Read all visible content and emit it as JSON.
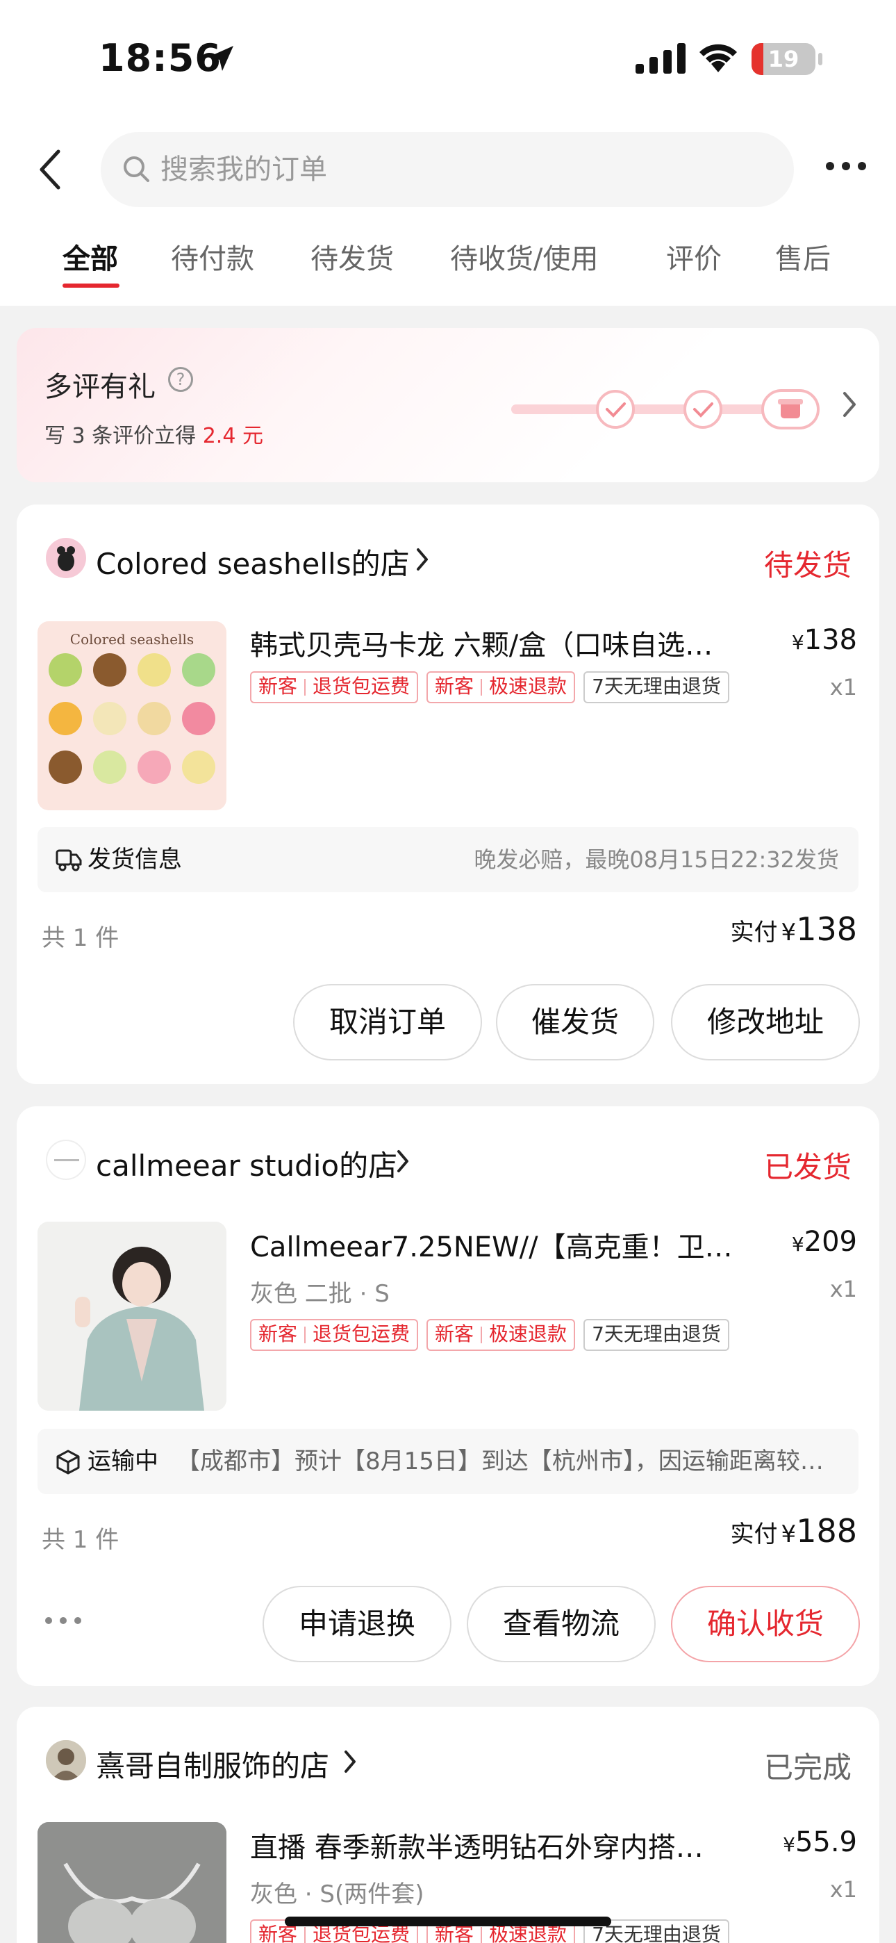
{
  "status_bar": {
    "time": "18:56",
    "battery": "19",
    "battery_level": 0.19
  },
  "nav": {
    "search_placeholder": "搜索我的订单"
  },
  "tabs": [
    {
      "label": "全部",
      "active": true
    },
    {
      "label": "待付款",
      "active": false
    },
    {
      "label": "待发货",
      "active": false
    },
    {
      "label": "待收货/使用",
      "active": false
    },
    {
      "label": "评价",
      "active": false
    },
    {
      "label": "售后",
      "active": false
    }
  ],
  "promo": {
    "title": "多评有礼",
    "subtitle_prefix": "写 3 条评价立得 ",
    "subtitle_amount": "2.4 元"
  },
  "orders": [
    {
      "shop": "Colored seashells的店",
      "status": "待发货",
      "title": "韩式贝壳马卡龙 六颗/盒（口味自选…",
      "price_symbol": "¥",
      "price": "138",
      "qty": "x1",
      "tags": [
        {
          "a": "新客",
          "b": "退货包运费"
        },
        {
          "a": "新客",
          "b": "极速退款"
        },
        {
          "plain": "7天无理由退货"
        }
      ],
      "info_label": "发货信息",
      "info_text": "晚发必赔，最晚08月15日22:32发货",
      "count": "共 1 件",
      "paid_label": "实付",
      "paid_symbol": "¥",
      "paid_amount": "138",
      "buttons": [
        "取消订单",
        "催发货",
        "修改地址"
      ],
      "thumb_title": "Colored seashells"
    },
    {
      "shop": "callmeear studio的店",
      "status": "已发货",
      "title": "Callmeear7.25NEW//【高克重！卫衣…",
      "price_symbol": "¥",
      "price": "209",
      "qty": "x1",
      "spec": "灰色 二批 · S",
      "tags": [
        {
          "a": "新客",
          "b": "退货包运费"
        },
        {
          "a": "新客",
          "b": "极速退款"
        },
        {
          "plain": "7天无理由退货"
        }
      ],
      "info_label": "运输中",
      "info_text": "【成都市】预计【8月15日】到达【杭州市】，因运输距离较…",
      "count": "共 1 件",
      "paid_label": "实付",
      "paid_symbol": "¥",
      "paid_amount": "188",
      "buttons": [
        "申请退换",
        "查看物流",
        "确认收货"
      ]
    },
    {
      "shop": "熹哥自制服饰的店",
      "status": "已完成",
      "title": "直播 春季新款半透明钻石外穿内搭…",
      "price_symbol": "¥",
      "price": "55.9",
      "qty": "x1",
      "spec": "灰色 · S(两件套)",
      "tags": [
        {
          "a": "新客",
          "b": "退货包运费"
        },
        {
          "a": "新客",
          "b": "极速退款"
        },
        {
          "plain": "7天无理由退货"
        }
      ]
    }
  ],
  "colors": {
    "accent": "#e5272f",
    "background": "#f2f2f2"
  }
}
